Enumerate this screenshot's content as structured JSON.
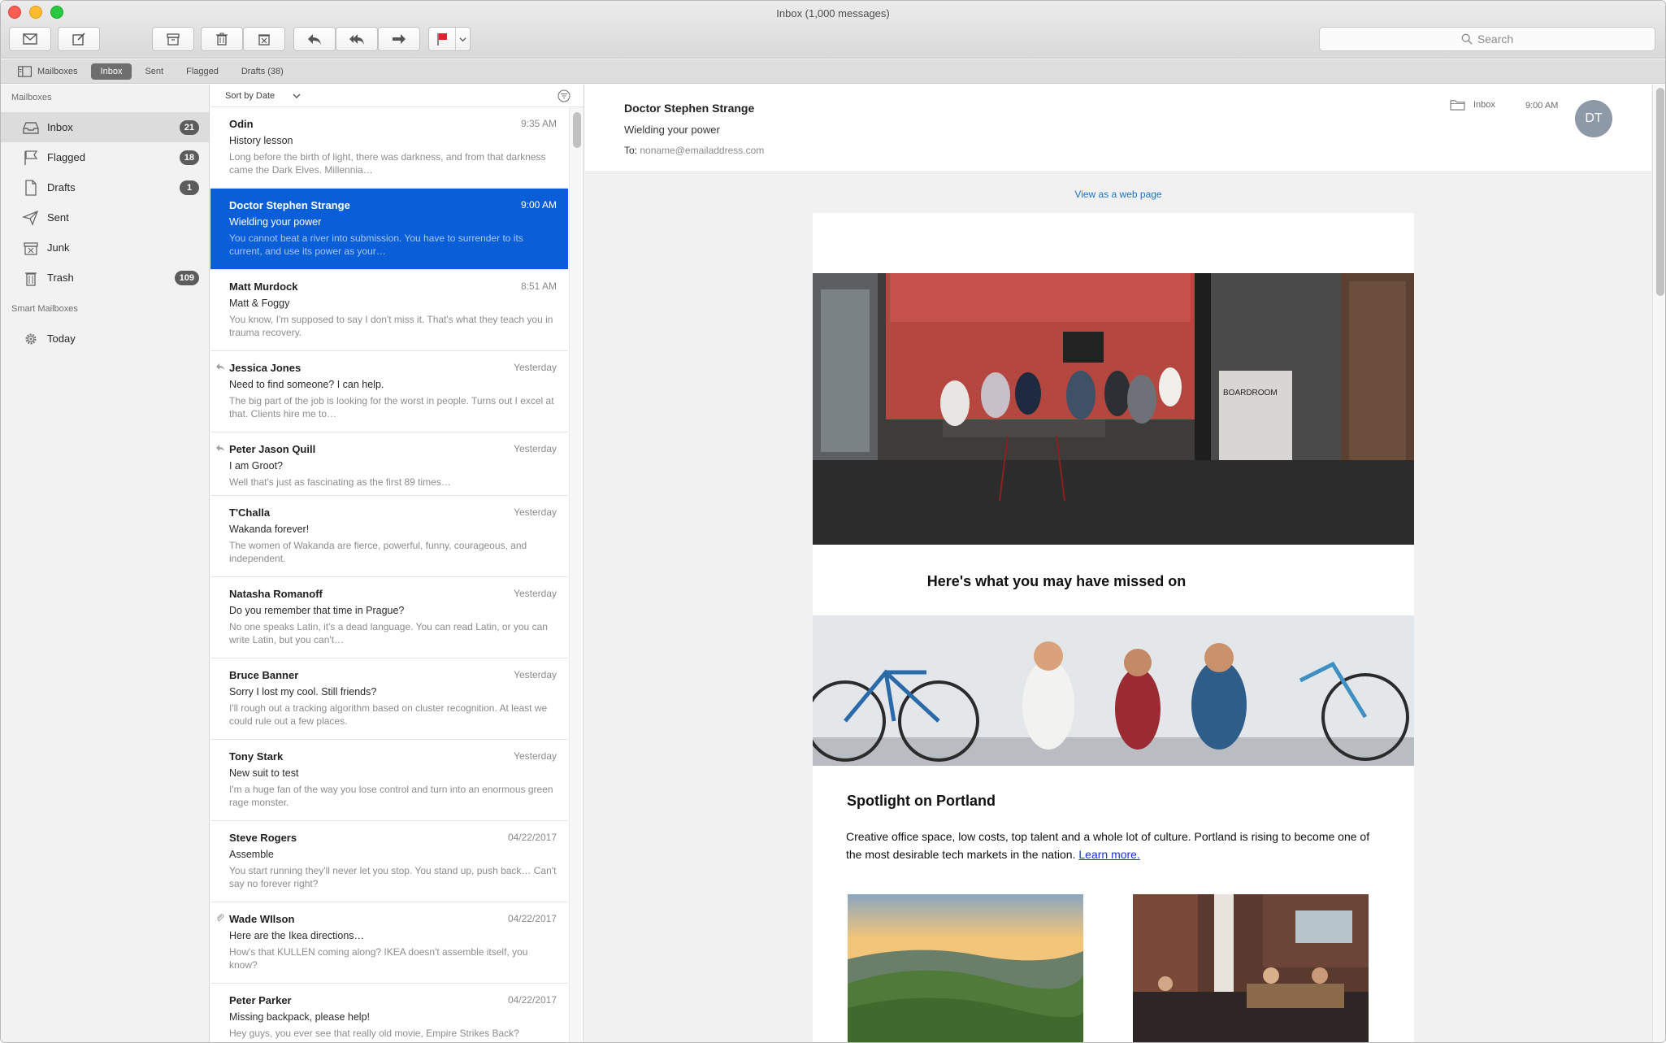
{
  "window": {
    "title": "Inbox (1,000 messages)"
  },
  "toolbar": {
    "buttons": [
      "get-mail",
      "compose",
      "archive",
      "delete",
      "junk",
      "reply",
      "reply-all",
      "forward",
      "flag"
    ],
    "search_placeholder": "Search"
  },
  "favorites": {
    "items": [
      {
        "label": "Mailboxes"
      },
      {
        "label": "Inbox"
      },
      {
        "label": "Sent"
      },
      {
        "label": "Flagged"
      },
      {
        "label": "Drafts (38)"
      }
    ]
  },
  "sidebar": {
    "mailboxes_header": "Mailboxes",
    "items": [
      {
        "label": "Inbox",
        "count": "21",
        "icon": "inbox-icon"
      },
      {
        "label": "Flagged",
        "count": "18",
        "icon": "flag-icon"
      },
      {
        "label": "Drafts",
        "count": "1",
        "icon": "document-icon"
      },
      {
        "label": "Sent",
        "count": "",
        "icon": "paper-plane-icon"
      },
      {
        "label": "Junk",
        "count": "",
        "icon": "junk-icon"
      },
      {
        "label": "Trash",
        "count": "109",
        "icon": "trash-icon"
      }
    ],
    "smart_header": "Smart Mailboxes",
    "smart_items": [
      {
        "label": "Today",
        "icon": "gear-icon"
      }
    ]
  },
  "list": {
    "sort_label": "Sort by Date",
    "messages": [
      {
        "from": "Odin",
        "time": "9:35 AM",
        "subject": "History lesson",
        "preview": "Long before the birth of light, there was darkness, and from that darkness came the Dark Elves. Millennia…"
      },
      {
        "from": "Doctor Stephen Strange",
        "time": "9:00 AM",
        "subject": "Wielding your power",
        "preview": "You cannot beat a river into submission. You have to surrender to its current, and use its power as your…"
      },
      {
        "from": "Matt Murdock",
        "time": "8:51 AM",
        "subject": "Matt & Foggy",
        "preview": "You know, I'm supposed to say I don't miss it. That's what they teach you in trauma recovery."
      },
      {
        "from": "Jessica Jones",
        "time": "Yesterday",
        "subject": "Need to find someone? I can help.",
        "preview": "The big part of the job is looking for the worst in people. Turns out I excel at that. Clients hire me to…"
      },
      {
        "from": "Peter Jason Quill",
        "time": "Yesterday",
        "subject": "I am Groot?",
        "preview": "Well that's just as fascinating as the first 89 times…"
      },
      {
        "from": "T'Challa",
        "time": "Yesterday",
        "subject": "Wakanda forever!",
        "preview": "The women of Wakanda are fierce, powerful, funny, courageous, and independent."
      },
      {
        "from": "Natasha Romanoff",
        "time": "Yesterday",
        "subject": "Do you remember that time in Prague?",
        "preview": "No one speaks Latin, it's a dead language. You can read Latin, or you can write Latin, but you can't…"
      },
      {
        "from": "Bruce Banner",
        "time": "Yesterday",
        "subject": "Sorry I lost my cool. Still friends?",
        "preview": "I'll rough out a tracking algorithm based on cluster recognition. At least we could rule out a few places."
      },
      {
        "from": "Tony Stark",
        "time": "Yesterday",
        "subject": "New suit to test",
        "preview": "I'm a huge fan of the way you lose control and turn into an enormous green rage monster."
      },
      {
        "from": "Steve Rogers",
        "time": "04/22/2017",
        "subject": "Assemble",
        "preview": "You start running they'll never let you stop. You stand up, push back… Can't say no forever right?"
      },
      {
        "from": "Wade WIlson",
        "time": "04/22/2017",
        "subject": "Here are the Ikea directions…",
        "preview": "How's that KULLEN coming along? IKEA doesn't assemble itself, you know?"
      },
      {
        "from": "Peter Parker",
        "time": "04/22/2017",
        "subject": "Missing backpack, please help!",
        "preview": "Hey guys, you ever see that really old movie, Empire Strikes Back?"
      }
    ]
  },
  "reader": {
    "sender": "Doctor Stephen Strange",
    "subject": "Wielding your power",
    "to_label": "To:",
    "to_address": "noname@emailaddress.com",
    "folder": "Inbox",
    "time": "9:00 AM",
    "avatar_initials": "DT",
    "view_web": "View as a web page",
    "email": {
      "hero_sign": "BOARDROOM",
      "missed_heading": "Here's what you may have missed on",
      "spotlight_title": "Spotlight on Portland",
      "spotlight_body": "Creative office space, low costs, top talent and a whole lot of culture. Portland is rising to become one of the most desirable tech markets in the nation.",
      "learn_more": "Learn more."
    }
  },
  "colors": {
    "selection": "#0a5fd8",
    "link": "#1a73c9",
    "flag": "#e2202d"
  }
}
